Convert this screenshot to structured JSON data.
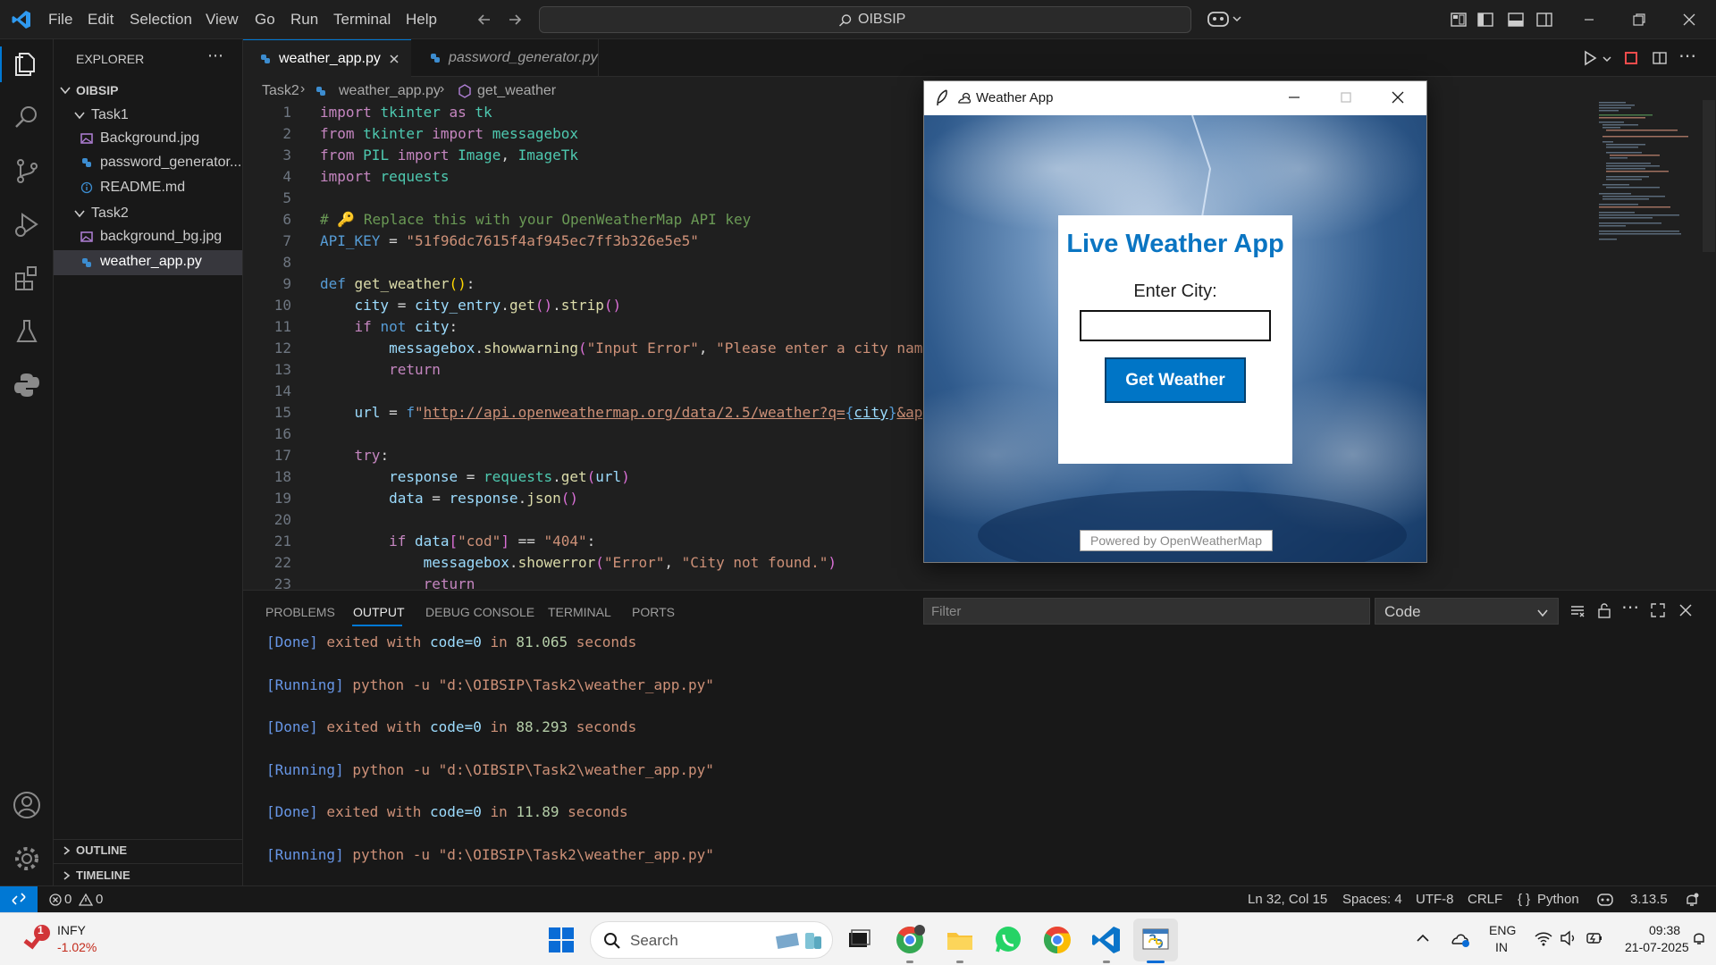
{
  "titlebar": {
    "menu": [
      "File",
      "Edit",
      "Selection",
      "View",
      "Go",
      "Run",
      "Terminal",
      "Help"
    ],
    "command_center": "OIBSIP"
  },
  "sidebar": {
    "header": "EXPLORER",
    "root": "OIBSIP",
    "folder1": "Task1",
    "task1_files": [
      "Background.jpg",
      "password_generator...",
      "README.md"
    ],
    "folder2": "Task2",
    "task2_files": [
      "background_bg.jpg",
      "weather_app.py"
    ],
    "outline": "OUTLINE",
    "timeline": "TIMELINE"
  },
  "tabs": {
    "active": "weather_app.py",
    "inactive": "password_generator.py"
  },
  "breadcrumb": {
    "folder": "Task2",
    "file": "weather_app.py",
    "symbol": "get_weather"
  },
  "code": {
    "line_numbers": [
      "1",
      "2",
      "3",
      "4",
      "5",
      "6",
      "7",
      "8",
      "9",
      "10",
      "11",
      "12",
      "13",
      "14",
      "15",
      "16",
      "17",
      "18",
      "19",
      "20",
      "21",
      "22",
      "23"
    ]
  },
  "tk_window": {
    "title": "Weather App",
    "heading": "Live Weather App",
    "city_label": "Enter City:",
    "input_value": "",
    "button": "Get Weather",
    "footer": "Powered by OpenWeatherMap"
  },
  "panel": {
    "tabs": [
      "PROBLEMS",
      "OUTPUT",
      "DEBUG CONSOLE",
      "TERMINAL",
      "PORTS"
    ],
    "active_tab": "OUTPUT",
    "filter_placeholder": "Filter",
    "channel": "Code",
    "output": [
      {
        "tag": "[Done]",
        "text": " exited with ",
        "code": "code=0",
        "mid": " in ",
        "num": "81.065",
        "end": " seconds"
      },
      {
        "tag": "[Running]",
        "text": " python -u ",
        "path": "\"d:\\OIBSIP\\Task2\\weather_app.py\""
      },
      {
        "tag": "[Done]",
        "text": " exited with ",
        "code": "code=0",
        "mid": " in ",
        "num": "88.293",
        "end": " seconds"
      },
      {
        "tag": "[Running]",
        "text": " python -u ",
        "path": "\"d:\\OIBSIP\\Task2\\weather_app.py\""
      },
      {
        "tag": "[Done]",
        "text": " exited with ",
        "code": "code=0",
        "mid": " in ",
        "num": "11.89",
        "end": " seconds"
      },
      {
        "tag": "[Running]",
        "text": " python -u ",
        "path": "\"d:\\OIBSIP\\Task2\\weather_app.py\""
      }
    ]
  },
  "status": {
    "errors": "0",
    "warnings": "0",
    "position": "Ln 32, Col 15",
    "spaces": "Spaces: 4",
    "encoding": "UTF-8",
    "eol": "CRLF",
    "language": "Python",
    "version": "3.13.5"
  },
  "taskbar": {
    "stock_symbol": "INFY",
    "stock_change": "-1.02%",
    "stock_badge": "1",
    "search": "Search",
    "lang1": "ENG",
    "lang2": "IN",
    "time": "09:38",
    "date": "21-07-2025"
  },
  "colors": {
    "accent": "#0078d4",
    "editor_bg": "#1f1f1f",
    "sidebar_bg": "#181818",
    "tk_button": "#0075c6"
  }
}
